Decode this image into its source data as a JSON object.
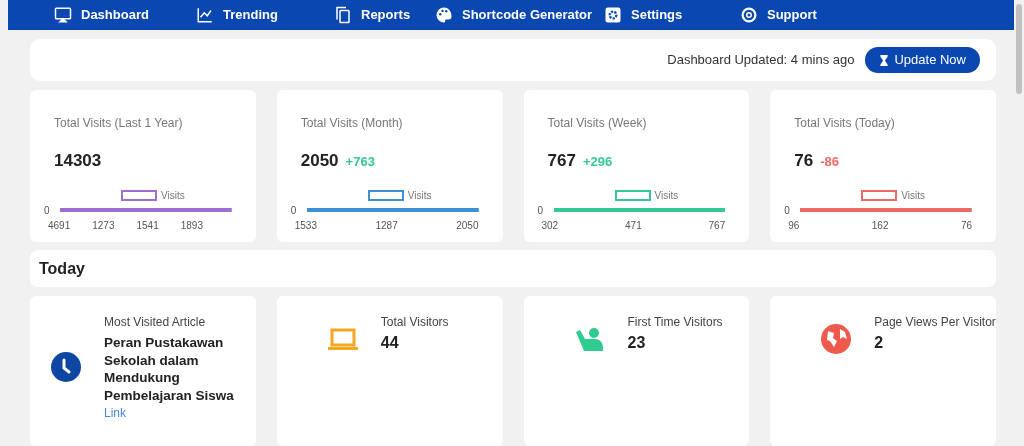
{
  "nav": [
    {
      "label": "Dashboard"
    },
    {
      "label": "Trending"
    },
    {
      "label": "Reports"
    },
    {
      "label": "Shortcode Generator"
    },
    {
      "label": "Settings"
    },
    {
      "label": "Support"
    }
  ],
  "update_bar": {
    "status": "Dashboard Updated: 4 mins ago",
    "button": "Update Now"
  },
  "stat_cards": [
    {
      "title": "Total Visits (Last 1 Year)",
      "value": "14303",
      "color": "#9b6fcf",
      "y_tick": "0",
      "legend": "Visits",
      "x_labels": [
        "4691",
        "1273",
        "1541",
        "1893"
      ]
    },
    {
      "title": "Total Visits (Month)",
      "value": "2050",
      "change": "+763",
      "negative": false,
      "color": "#3d8fd6",
      "y_tick": "0",
      "legend": "Visits",
      "x_labels": [
        "1533",
        "1287",
        "2050"
      ]
    },
    {
      "title": "Total Visits (Week)",
      "value": "767",
      "change": "+296",
      "negative": false,
      "color": "#35c896",
      "y_tick": "0",
      "legend": "Visits",
      "x_labels": [
        "302",
        "471",
        "767"
      ]
    },
    {
      "title": "Total Visits (Today)",
      "value": "76",
      "change": "-86",
      "negative": true,
      "color": "#eb6b64",
      "y_tick": "0",
      "legend": "Visits",
      "x_labels": [
        "96",
        "162",
        "76"
      ]
    }
  ],
  "today": {
    "heading": "Today",
    "cards": [
      {
        "label": "Most Visited Article",
        "value": "Peran Pustakawan Sekolah dalam Mendukung Pembelajaran Siswa",
        "link": "Link",
        "color": "#0d47a1"
      },
      {
        "label": "Total Visitors",
        "value": "44",
        "color": "#f5a623"
      },
      {
        "label": "First Time Visitors",
        "value": "23",
        "color": "#2fcb8f"
      },
      {
        "label": "Page Views Per Visitor",
        "value": "2",
        "color": "#ef5a4f"
      }
    ]
  }
}
